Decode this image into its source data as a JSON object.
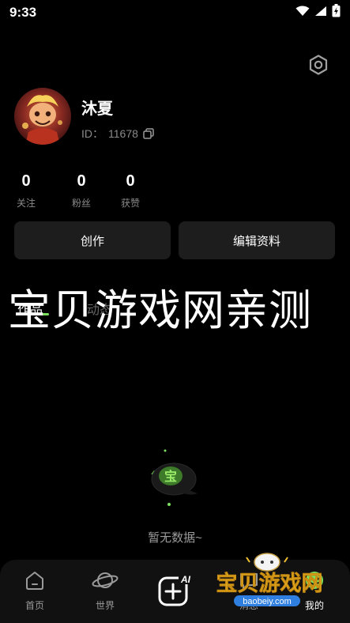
{
  "status_bar": {
    "time": "9:33"
  },
  "profile": {
    "nickname": "沐夏",
    "id_label": "ID：",
    "id_value": "11678"
  },
  "stats": [
    {
      "value": "0",
      "label": "关注"
    },
    {
      "value": "0",
      "label": "粉丝"
    },
    {
      "value": "0",
      "label": "获赞"
    }
  ],
  "actions": {
    "create": "创作",
    "edit_profile": "编辑资料"
  },
  "watermark": {
    "text": "宝贝游戏网亲测",
    "brand": "宝贝游戏网",
    "domain": "baobeiy.com"
  },
  "tabs": {
    "works": "作品",
    "moments": "动态"
  },
  "empty_state": {
    "text": "暂无数据~",
    "mascot_char": "宝"
  },
  "bottom_nav": {
    "home": "首页",
    "world": "世界",
    "create_badge": "AI",
    "messages": "消息",
    "mine": "我的"
  },
  "colors": {
    "accent": "#7be05c",
    "card": "#1d1d1d",
    "background": "#000000"
  }
}
